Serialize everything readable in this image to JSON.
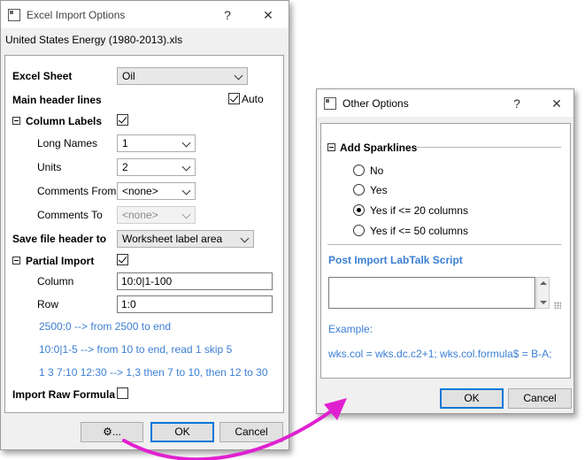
{
  "excel_dialog": {
    "title": "Excel Import Options",
    "help": "?",
    "close": "✕",
    "file_name": "United States Energy (1980-2013).xls",
    "excel_sheet": {
      "label": "Excel Sheet",
      "value": "Oil"
    },
    "main_header": {
      "label": "Main header lines",
      "auto_label": "Auto",
      "auto_checked": true
    },
    "column_labels": {
      "label": "Column Labels",
      "checked": true,
      "long_names": {
        "label": "Long Names",
        "value": "1"
      },
      "units": {
        "label": "Units",
        "value": "2"
      },
      "comments_from": {
        "label": "Comments From",
        "value": "<none>"
      },
      "comments_to": {
        "label": "Comments To",
        "value": "<none>"
      }
    },
    "save_file_header": {
      "label": "Save file header to",
      "value": "Worksheet label area"
    },
    "partial_import": {
      "label": "Partial Import",
      "checked": true,
      "column": {
        "label": "Column",
        "value": "10:0|1-100"
      },
      "row": {
        "label": "Row",
        "value": "1:0"
      },
      "hints": [
        "2500:0 --> from 2500 to end",
        "10:0|1-5 --> from 10 to end, read 1 skip 5",
        "1 3 7:10 12:30 --> 1,3 then 7 to 10, then 12 to 30"
      ]
    },
    "import_raw_formula": {
      "label": "Import Raw Formula",
      "checked": false
    },
    "buttons": {
      "more": "⚙...",
      "ok": "OK",
      "cancel": "Cancel"
    }
  },
  "other_dialog": {
    "title": "Other Options",
    "help": "?",
    "close": "✕",
    "add_sparklines": {
      "label": "Add Sparklines",
      "options": [
        "No",
        "Yes",
        "Yes if <= 20 columns",
        "Yes if <= 50 columns"
      ],
      "selected_index": 2
    },
    "script": {
      "label": "Post Import LabTalk Script",
      "value": ""
    },
    "example_label": "Example:",
    "example_text": "wks.col = wks.dc.c2+1; wks.col.formula$ = B-A;",
    "buttons": {
      "ok": "OK",
      "cancel": "Cancel"
    }
  },
  "colors": {
    "accent_blue": "#3b7fd4",
    "arrow_magenta": "#e020d0"
  }
}
